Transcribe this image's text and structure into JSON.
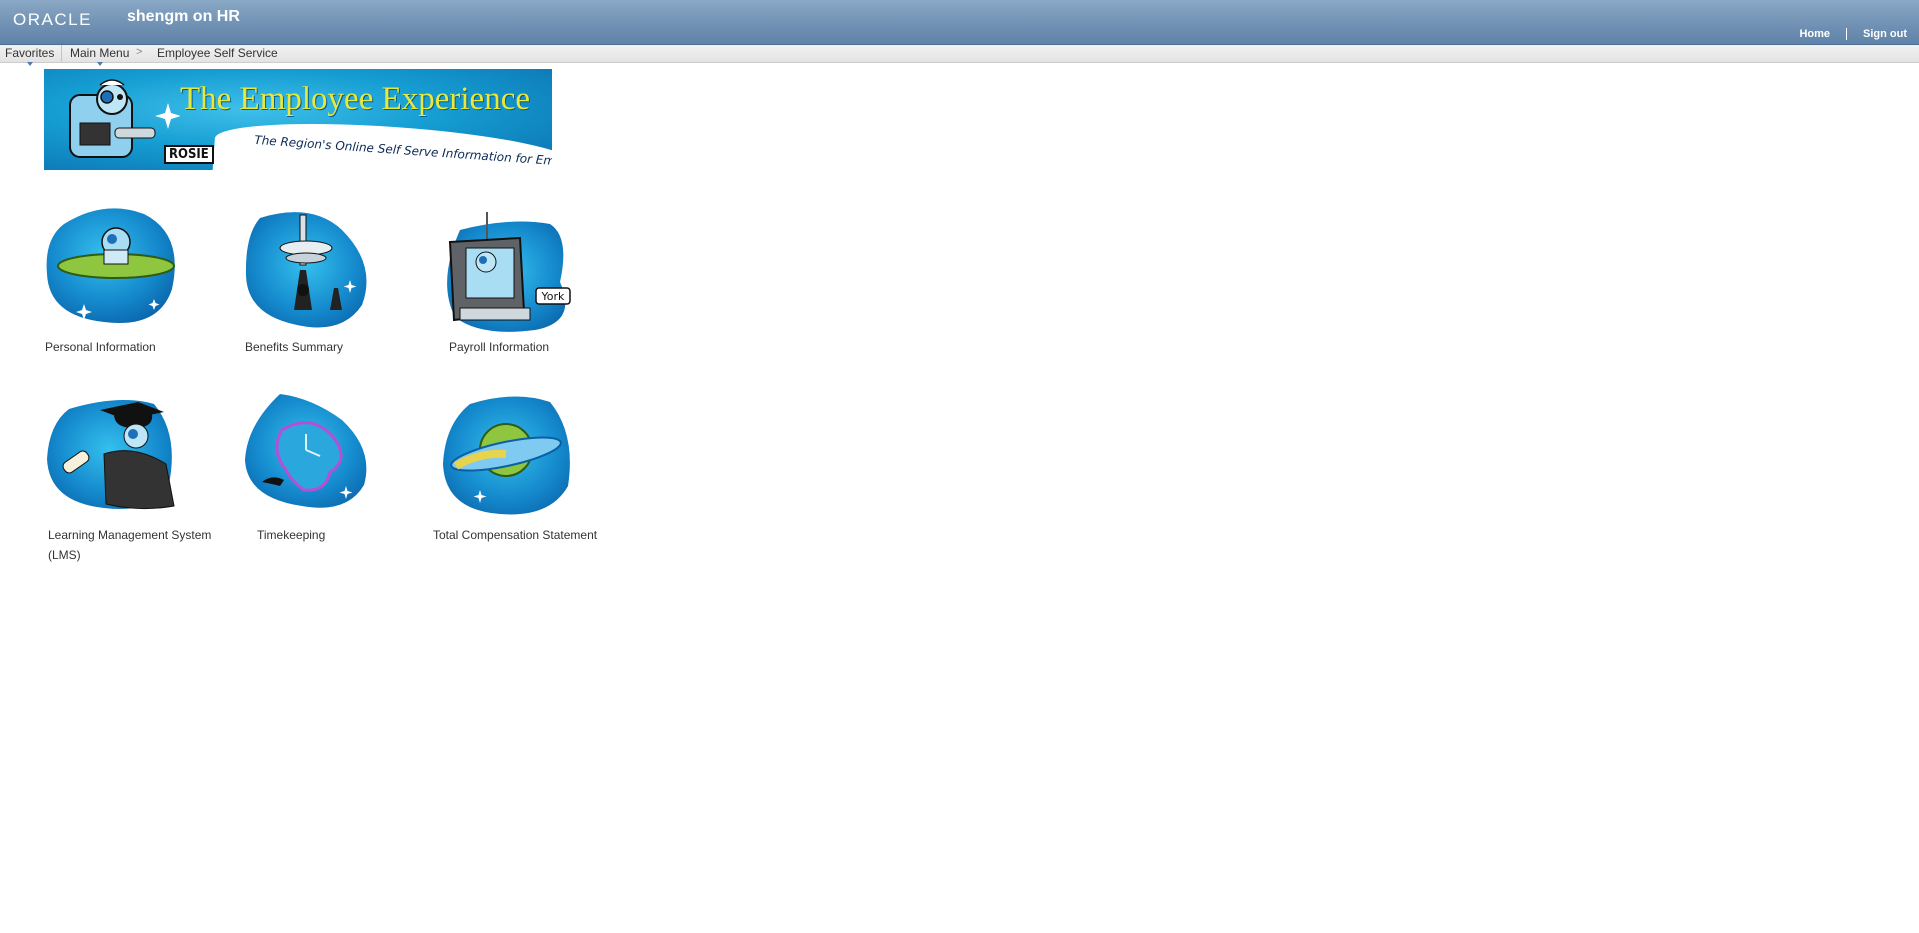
{
  "header": {
    "logo": "ORACLE",
    "title": "shengm on HR",
    "links": {
      "home": "Home",
      "signout": "Sign out"
    }
  },
  "nav": {
    "favorites": "Favorites",
    "main_menu": "Main Menu",
    "breadcrumb_sep": ">",
    "current": "Employee Self Service"
  },
  "banner": {
    "title": "The Employee Experience",
    "subtitle": "The Region's Online Self Serve Information for Employees",
    "badge": "ROSIE"
  },
  "tiles": [
    {
      "label": "Personal Information",
      "icon": "robot-on-saucer-icon"
    },
    {
      "label": "Benefits Summary",
      "icon": "space-tower-icon"
    },
    {
      "label": "Payroll Information",
      "icon": "robot-computer-icon",
      "badge": "York"
    },
    {
      "label": "Learning Management System (LMS)",
      "icon": "graduate-robot-icon"
    },
    {
      "label": "Timekeeping",
      "icon": "melting-clock-icon"
    },
    {
      "label": "Total Compensation Statement",
      "icon": "planet-icon"
    }
  ],
  "colors": {
    "header": "#7192b4",
    "tile_blue": "#1a8fd0",
    "banner_title": "#e8e83a"
  }
}
